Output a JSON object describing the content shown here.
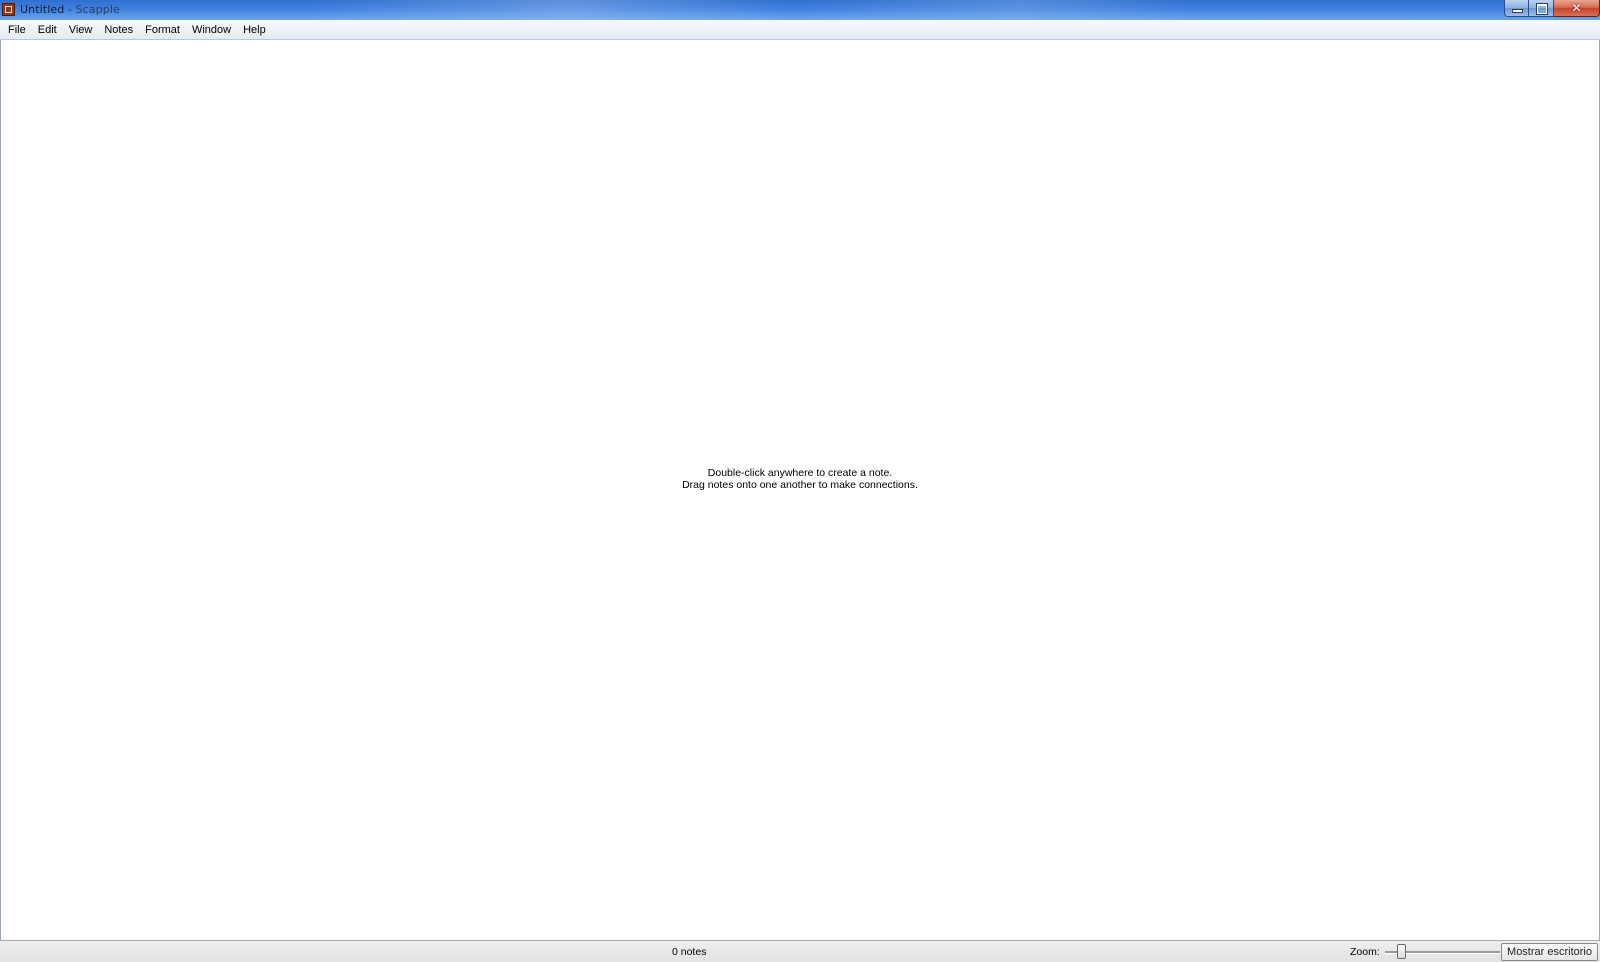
{
  "window": {
    "title": "Untitled",
    "title_separator": " - ",
    "app_name": "Scapple",
    "controls": {
      "minimize": "minimize-icon",
      "maximize": "restore-icon",
      "close_glyph": "✕"
    }
  },
  "menu": {
    "items": [
      "File",
      "Edit",
      "View",
      "Notes",
      "Format",
      "Window",
      "Help"
    ]
  },
  "canvas": {
    "hint_line1": "Double-click anywhere to create a note.",
    "hint_line2": "Drag notes onto one another to make connections."
  },
  "status": {
    "note_count": "0 notes",
    "zoom_label": "Zoom:",
    "show_desktop": "Mostrar escritorio"
  },
  "colors": {
    "titlebar": "#3f80de",
    "menubar": "#e5ebf4",
    "canvas": "#ffffff",
    "statusbar": "#e3e3e3"
  }
}
